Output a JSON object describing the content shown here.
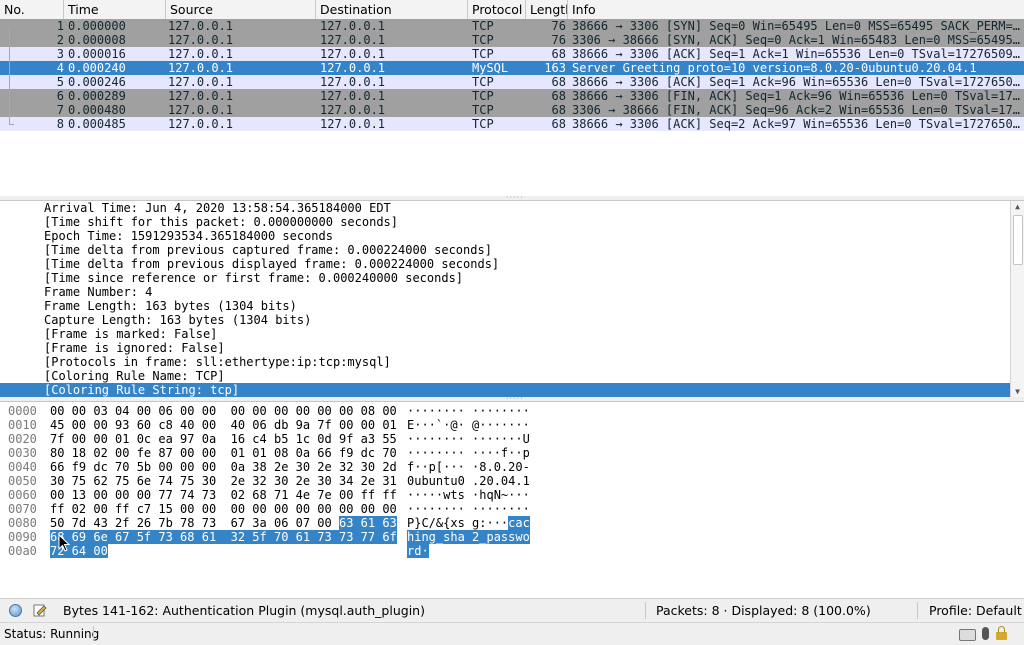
{
  "packet_list": {
    "columns": [
      "No.",
      "Time",
      "Source",
      "Destination",
      "Protocol",
      "Length",
      "Info"
    ],
    "rows": [
      {
        "no": "1",
        "time": "0.000000",
        "src": "127.0.0.1",
        "dst": "127.0.0.1",
        "proto": "TCP",
        "len": "76",
        "info": "38666 → 3306 [SYN] Seq=0 Win=65495 Len=0 MSS=65495 SACK_PERM=…",
        "bg": "#a0a0a0",
        "fg": "#12272e"
      },
      {
        "no": "2",
        "time": "0.000008",
        "src": "127.0.0.1",
        "dst": "127.0.0.1",
        "proto": "TCP",
        "len": "76",
        "info": "3306 → 38666 [SYN, ACK] Seq=0 Ack=1 Win=65483 Len=0 MSS=65495…",
        "bg": "#a0a0a0",
        "fg": "#12272e"
      },
      {
        "no": "3",
        "time": "0.000016",
        "src": "127.0.0.1",
        "dst": "127.0.0.1",
        "proto": "TCP",
        "len": "68",
        "info": "38666 → 3306 [ACK] Seq=1 Ack=1 Win=65536 Len=0 TSval=17276509…",
        "bg": "#e7e6ff",
        "fg": "#12272e"
      },
      {
        "no": "4",
        "time": "0.000240",
        "src": "127.0.0.1",
        "dst": "127.0.0.1",
        "proto": "MySQL",
        "len": "163",
        "info": "Server Greeting proto=10 version=8.0.20-0ubuntu0.20.04.1",
        "bg": "#3584c8",
        "fg": "#ffffff"
      },
      {
        "no": "5",
        "time": "0.000246",
        "src": "127.0.0.1",
        "dst": "127.0.0.1",
        "proto": "TCP",
        "len": "68",
        "info": "38666 → 3306 [ACK] Seq=1 Ack=96 Win=65536 Len=0 TSval=1727650…",
        "bg": "#e7e6ff",
        "fg": "#12272e"
      },
      {
        "no": "6",
        "time": "0.000289",
        "src": "127.0.0.1",
        "dst": "127.0.0.1",
        "proto": "TCP",
        "len": "68",
        "info": "38666 → 3306 [FIN, ACK] Seq=1 Ack=96 Win=65536 Len=0 TSval=17…",
        "bg": "#a0a0a0",
        "fg": "#12272e"
      },
      {
        "no": "7",
        "time": "0.000480",
        "src": "127.0.0.1",
        "dst": "127.0.0.1",
        "proto": "TCP",
        "len": "68",
        "info": "3306 → 38666 [FIN, ACK] Seq=96 Ack=2 Win=65536 Len=0 TSval=17…",
        "bg": "#a0a0a0",
        "fg": "#12272e"
      },
      {
        "no": "8",
        "time": "0.000485",
        "src": "127.0.0.1",
        "dst": "127.0.0.1",
        "proto": "TCP",
        "len": "68",
        "info": "38666 → 3306 [ACK] Seq=2 Ack=97 Win=65536 Len=0 TSval=1727650…",
        "bg": "#e7e6ff",
        "fg": "#12272e"
      }
    ]
  },
  "details": {
    "lines": [
      "Arrival Time: Jun  4, 2020 13:58:54.365184000 EDT",
      "[Time shift for this packet: 0.000000000 seconds]",
      "Epoch Time: 1591293534.365184000 seconds",
      "[Time delta from previous captured frame: 0.000224000 seconds]",
      "[Time delta from previous displayed frame: 0.000224000 seconds]",
      "[Time since reference or first frame: 0.000240000 seconds]",
      "Frame Number: 4",
      "Frame Length: 163 bytes (1304 bits)",
      "Capture Length: 163 bytes (1304 bits)",
      "[Frame is marked: False]",
      "[Frame is ignored: False]",
      "[Protocols in frame: sll:ethertype:ip:tcp:mysql]",
      "[Coloring Rule Name: TCP]",
      "[Coloring Rule String: tcp]"
    ],
    "selected_index": 13
  },
  "hex": {
    "rows": [
      {
        "off": "0000",
        "bytes": "00 00 03 04 00 06 00 00  00 00 00 00 00 00 08 00",
        "ascii": "········ ········"
      },
      {
        "off": "0010",
        "bytes": "45 00 00 93 60 c8 40 00  40 06 db 9a 7f 00 00 01",
        "ascii": "E···`·@· @·······"
      },
      {
        "off": "0020",
        "bytes": "7f 00 00 01 0c ea 97 0a  16 c4 b5 1c 0d 9f a3 55",
        "ascii": "········ ·······U"
      },
      {
        "off": "0030",
        "bytes": "80 18 02 00 fe 87 00 00  01 01 08 0a 66 f9 dc 70",
        "ascii": "········ ····f··p"
      },
      {
        "off": "0040",
        "bytes": "66 f9 dc 70 5b 00 00 00  0a 38 2e 30 2e 32 30 2d",
        "ascii": "f··p[··· ·8.0.20-"
      },
      {
        "off": "0050",
        "bytes": "30 75 62 75 6e 74 75 30  2e 32 30 2e 30 34 2e 31",
        "ascii": "0ubuntu0 .20.04.1"
      },
      {
        "off": "0060",
        "bytes": "00 13 00 00 00 77 74 73  02 68 71 4e 7e 00 ff ff",
        "ascii": "·····wts ·hqN~···"
      },
      {
        "off": "0070",
        "bytes": "ff 02 00 ff c7 15 00 00  00 00 00 00 00 00 00 00",
        "ascii": "········ ········"
      },
      {
        "off": "0080",
        "bytes_plain": "50 7d 43 2f 26 7b 78 73  67 3a 06 07 00 ",
        "bytes_hl": "63 61 63",
        "ascii_plain": "P}C/&{xs g:···",
        "ascii_hl": "cac"
      },
      {
        "off": "0090",
        "bytes_hl": "68 69 6e 67 5f 73 68 61  32 5f 70 61 73 73 77 6f",
        "ascii_hl": "hing_sha 2_passwo"
      },
      {
        "off": "00a0",
        "bytes_hl": "72 64 00",
        "ascii_hl": "rd·"
      }
    ]
  },
  "statusbar": {
    "field_info": "Bytes 141-162: Authentication Plugin (mysql.auth_plugin)",
    "packets": "Packets: 8 · Displayed: 8 (100.0%)",
    "profile": "Profile: Default",
    "status": "Status: Running"
  },
  "icons": [
    "expert-info-icon",
    "capture-comment-icon",
    "keyboard-icon",
    "microphone-icon",
    "lock-icon",
    "mouse-cursor-icon"
  ],
  "colors": {
    "selection": "#3584c8",
    "tcp_syn_fin": "#a0a0a0",
    "tcp": "#e7e6ff"
  }
}
